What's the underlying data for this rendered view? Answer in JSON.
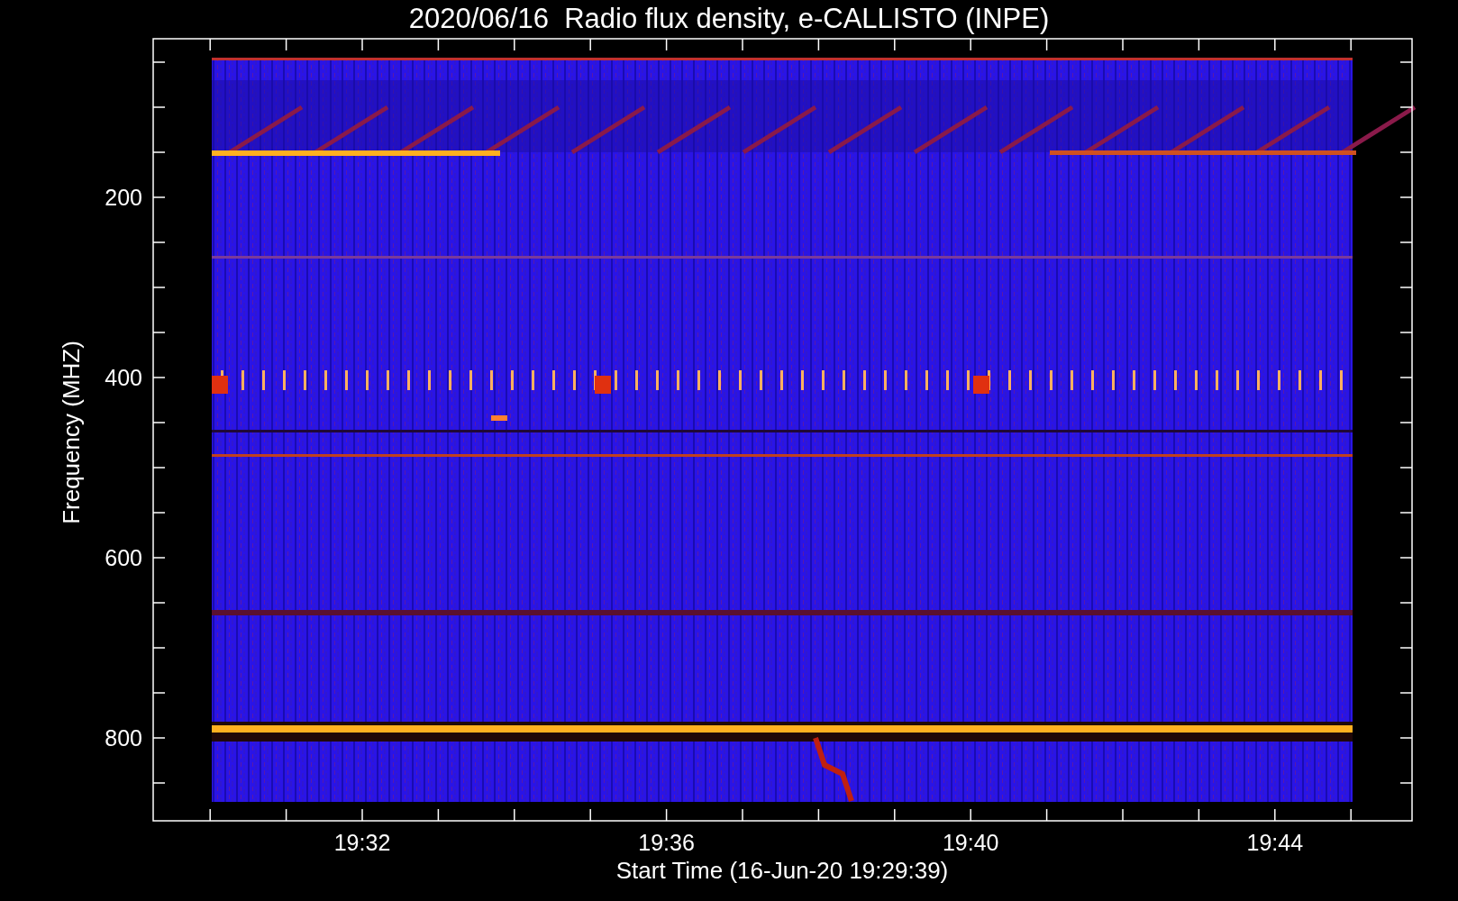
{
  "title": "2020/06/16  Radio flux density, e-CALLISTO (INPE)",
  "y_axis": {
    "label": "Frequency (MHZ)",
    "ticks": [
      "200",
      "400",
      "600",
      "800"
    ]
  },
  "x_axis": {
    "label": "Start Time (16-Jun-20 19:29:39)",
    "ticks": [
      "19:32",
      "19:36",
      "19:40",
      "19:44"
    ]
  }
}
